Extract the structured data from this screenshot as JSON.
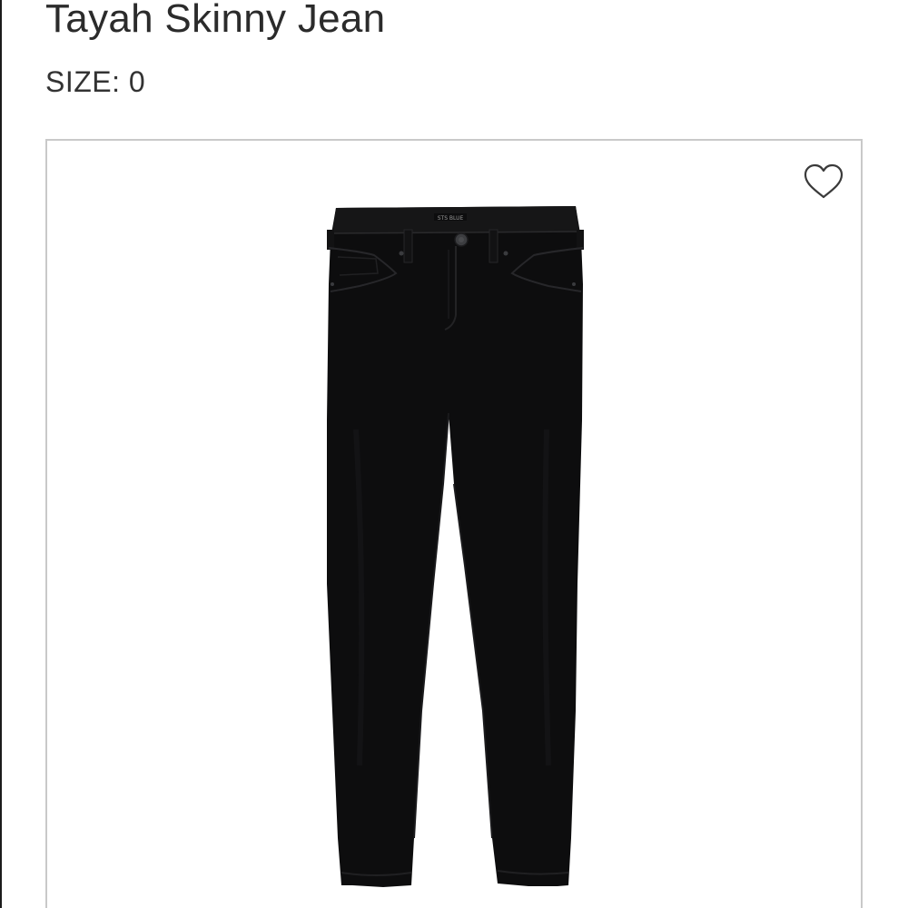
{
  "product": {
    "title": "Tayah Skinny Jean",
    "size_label": "SIZE: 0"
  },
  "image": {
    "subject": "black skinny jeans",
    "brand_tag_text": "STS BLUE"
  },
  "favorite": {
    "icon": "heart-outline-icon",
    "state": "not-favorited"
  },
  "colors": {
    "text": "#2b2b2b",
    "border": "#c9c9c9",
    "denim": "#0d0d0e"
  }
}
